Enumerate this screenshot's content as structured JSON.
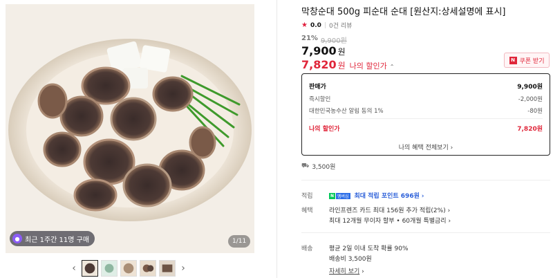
{
  "gallery": {
    "recent_purchase": "최근 1주간 11명 구매",
    "page_counter": "1/11",
    "thumbnails": [
      "thumb-1",
      "thumb-2",
      "thumb-3",
      "thumb-4",
      "thumb-5"
    ],
    "prev_icon": "‹",
    "next_icon": "›"
  },
  "product": {
    "title": "막창순대 500g 피순대 순대 [원산지:상세설명에 표시]",
    "rating": "0.0",
    "reviews": "0건 리뷰",
    "discount_pct": "21%",
    "original_price": "9,900원",
    "price": "7,900",
    "price_unit": "원",
    "my_price": "7,820",
    "my_price_unit": "원",
    "my_price_label": "나의 할인가",
    "coupon_button": "쿠폰 받기"
  },
  "price_box": {
    "sale_label": "판매가",
    "sale_value": "9,900원",
    "instant_label": "즉시할인",
    "instant_value": "-2,000원",
    "alert_label": "대한민국농수산 알림 동의 1%",
    "alert_value": "-80원",
    "my_label": "나의 할인가",
    "my_value": "7,820원",
    "view_all": "나의 혜택 전체보기"
  },
  "shipping_fee_line": "3,500원",
  "points": {
    "label": "적립",
    "badge_green": "N",
    "badge_blue": "멤버십",
    "text": "최대 적립 포인트 696원"
  },
  "benefits": {
    "label": "혜택",
    "line1": "라인프렌즈 카드 최대 156원 추가 적립(2%)",
    "line2": "최대 12개월 무이자 할부 • 60개월 특별금리"
  },
  "delivery": {
    "label": "배송",
    "line1": "평균 2일 이내 도착 확률 90%",
    "line2": "배송비 3,500원",
    "details_link": "자세히 보기"
  },
  "colors": {
    "accent_red": "#e0263a",
    "blue": "#2b5fd9",
    "naver_green": "#03c75a"
  }
}
